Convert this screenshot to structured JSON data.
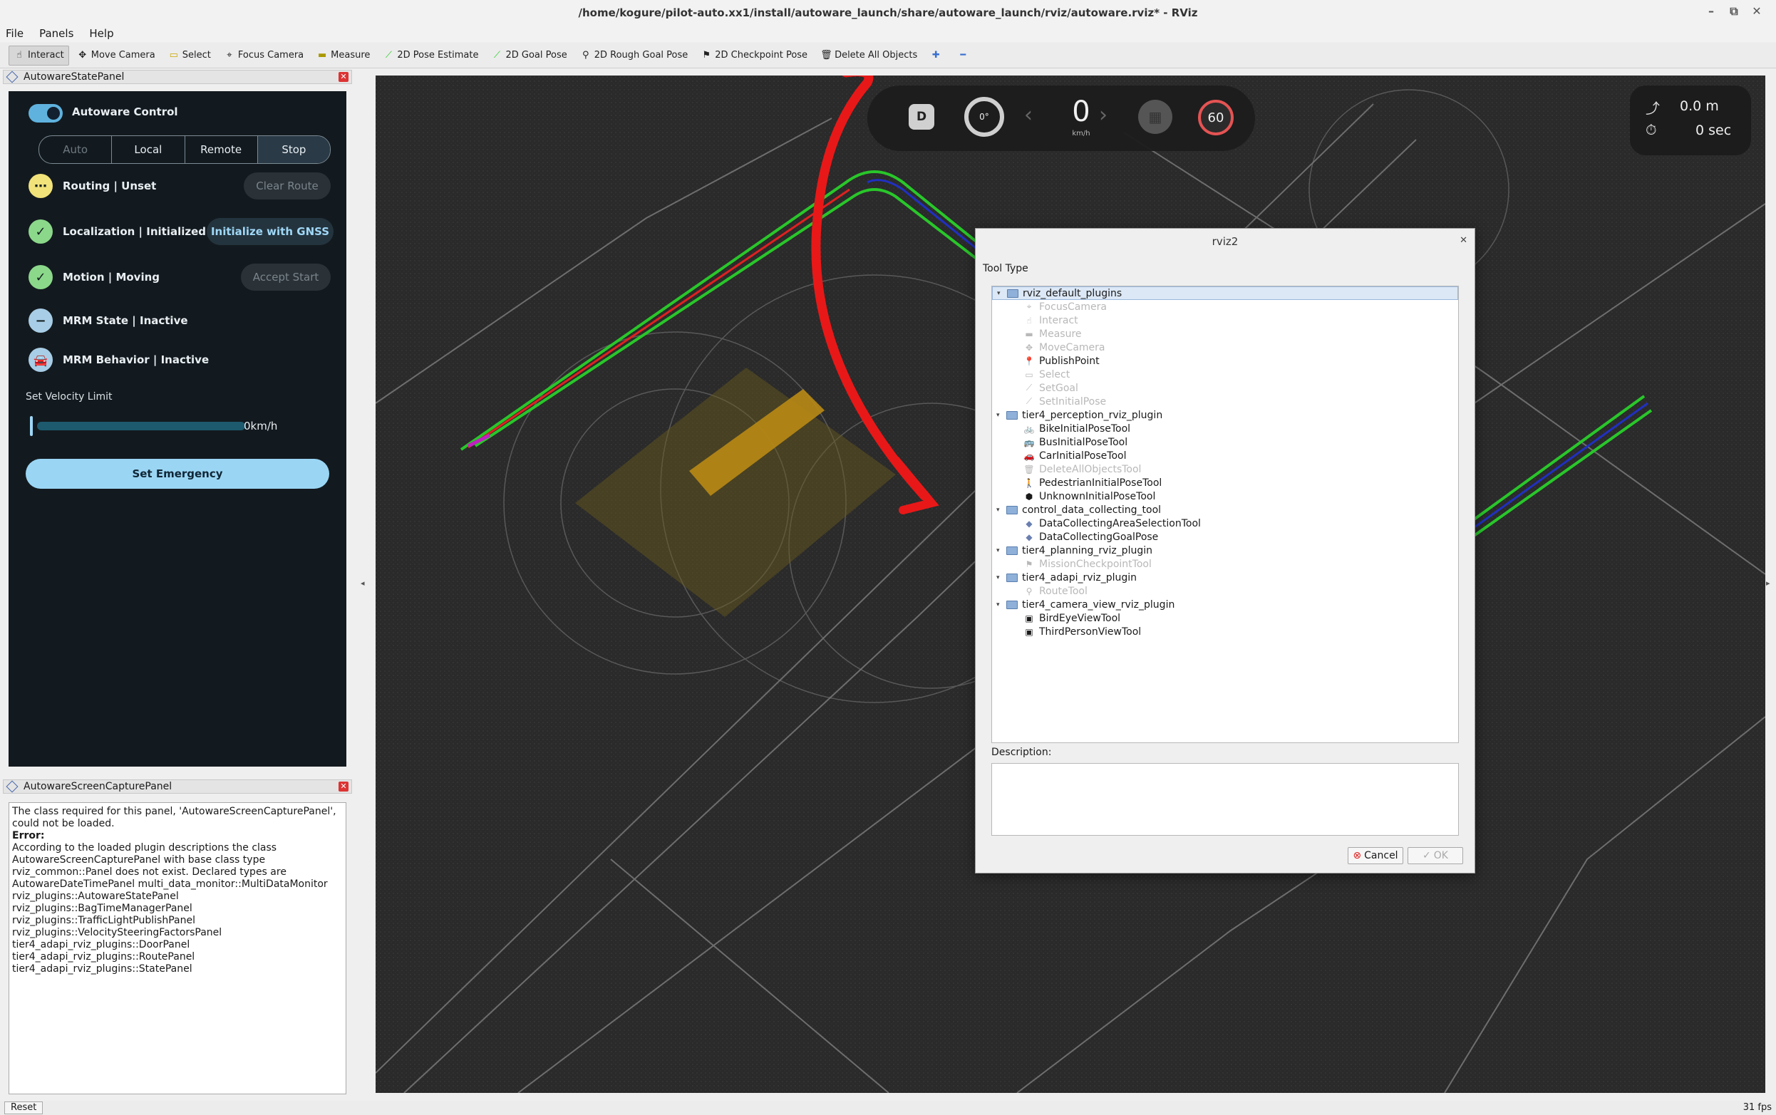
{
  "window": {
    "title": "/home/kogure/pilot-auto.xx1/install/autoware_launch/share/autoware_launch/rviz/autoware.rviz* - RViz"
  },
  "menu": [
    "File",
    "Panels",
    "Help"
  ],
  "toolbar": {
    "tools": [
      "Interact",
      "Move Camera",
      "Select",
      "Focus Camera",
      "Measure",
      "2D Pose Estimate",
      "2D Goal Pose",
      "2D Rough Goal Pose",
      "2D Checkpoint Pose",
      "Delete All Objects"
    ]
  },
  "state_panel": {
    "title": "AutowareStatePanel",
    "control_label": "Autoware Control",
    "modes": [
      "Auto",
      "Local",
      "Remote",
      "Stop"
    ],
    "rows": [
      {
        "label": "Routing | Unset",
        "button": "Clear Route"
      },
      {
        "label": "Localization | Initialized",
        "button": "Initialize with GNSS"
      },
      {
        "label": "Motion | Moving",
        "button": "Accept Start"
      },
      {
        "label": "MRM State | Inactive"
      },
      {
        "label": "MRM Behavior | Inactive"
      }
    ],
    "velocity_title": "Set Velocity Limit",
    "velocity_value": "0km/h",
    "emergency_label": "Set Emergency"
  },
  "capture_panel": {
    "title": "AutowareScreenCapturePanel",
    "lines": [
      "The class required for this panel, 'AutowareScreenCapturePanel',",
      "could not be loaded.",
      "Error:",
      "According to the loaded plugin descriptions the class",
      "AutowareScreenCapturePanel with base class type",
      "rviz_common::Panel does not exist. Declared types are",
      "AutowareDateTimePanel multi_data_monitor::MultiDataMonitor",
      "rviz_plugins::AutowareStatePanel",
      "rviz_plugins::BagTimeManagerPanel",
      "rviz_plugins::TrafficLightPublishPanel",
      "rviz_plugins::VelocitySteeringFactorsPanel",
      "tier4_adapi_rviz_plugins::DoorPanel",
      "tier4_adapi_rviz_plugins::RoutePanel",
      "tier4_adapi_rviz_plugins::StatePanel"
    ]
  },
  "hud": {
    "gear": "D",
    "steering": "0°",
    "speed": "0",
    "speed_unit": "km/h",
    "speed_limit": "60",
    "distance": "0.0 m",
    "time": "0 sec"
  },
  "dialog": {
    "title": "rviz2",
    "tool_type_label": "Tool Type",
    "description_label": "Description:",
    "cancel": "Cancel",
    "ok": "OK",
    "tree": [
      {
        "category": "rviz_default_plugins",
        "items": [
          {
            "name": "FocusCamera",
            "enabled": false
          },
          {
            "name": "Interact",
            "enabled": false
          },
          {
            "name": "Measure",
            "enabled": false
          },
          {
            "name": "MoveCamera",
            "enabled": false
          },
          {
            "name": "PublishPoint",
            "enabled": true
          },
          {
            "name": "Select",
            "enabled": false
          },
          {
            "name": "SetGoal",
            "enabled": false
          },
          {
            "name": "SetInitialPose",
            "enabled": false
          }
        ]
      },
      {
        "category": "tier4_perception_rviz_plugin",
        "items": [
          {
            "name": "BikeInitialPoseTool",
            "enabled": true
          },
          {
            "name": "BusInitialPoseTool",
            "enabled": true
          },
          {
            "name": "CarInitialPoseTool",
            "enabled": true
          },
          {
            "name": "DeleteAllObjectsTool",
            "enabled": false
          },
          {
            "name": "PedestrianInitialPoseTool",
            "enabled": true
          },
          {
            "name": "UnknownInitialPoseTool",
            "enabled": true
          }
        ]
      },
      {
        "category": "control_data_collecting_tool",
        "items": [
          {
            "name": "DataCollectingAreaSelectionTool",
            "enabled": true
          },
          {
            "name": "DataCollectingGoalPose",
            "enabled": true
          }
        ]
      },
      {
        "category": "tier4_planning_rviz_plugin",
        "items": [
          {
            "name": "MissionCheckpointTool",
            "enabled": false
          }
        ]
      },
      {
        "category": "tier4_adapi_rviz_plugin",
        "items": [
          {
            "name": "RouteTool",
            "enabled": false
          }
        ]
      },
      {
        "category": "tier4_camera_view_rviz_plugin",
        "items": [
          {
            "name": "BirdEyeViewTool",
            "enabled": true
          },
          {
            "name": "ThirdPersonViewTool",
            "enabled": true
          }
        ]
      }
    ]
  },
  "status": {
    "reset": "Reset",
    "fps": "31 fps"
  }
}
